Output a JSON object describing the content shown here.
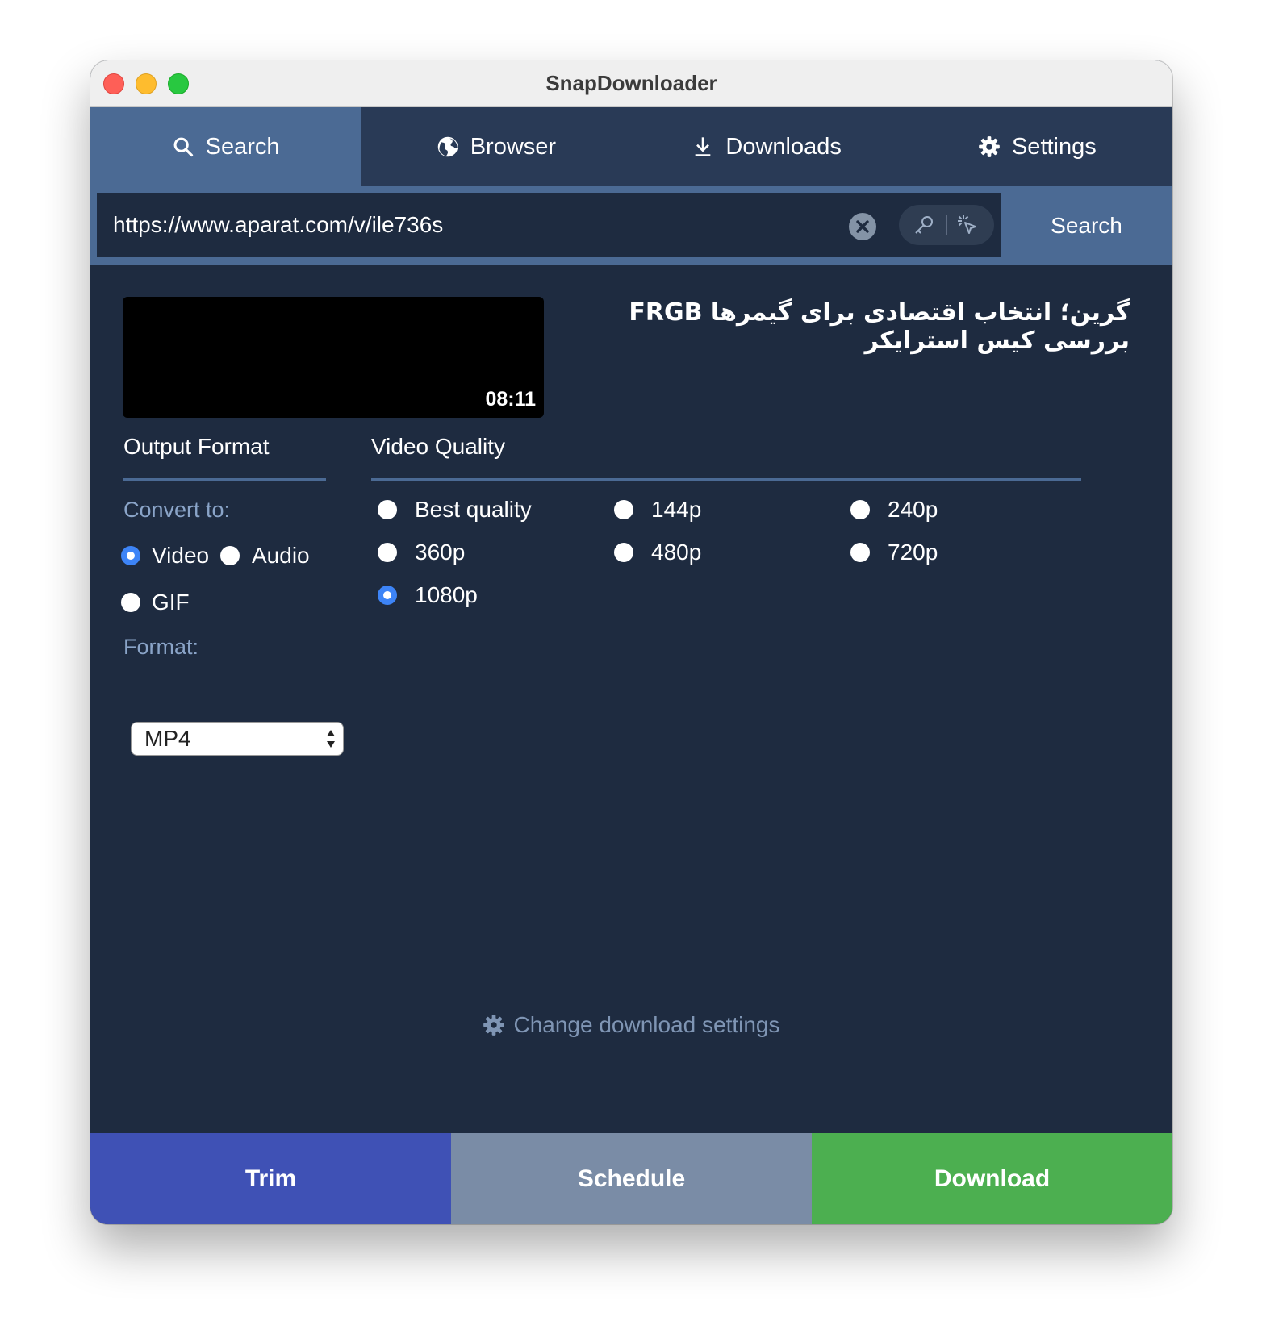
{
  "window": {
    "title": "SnapDownloader"
  },
  "tabs": [
    {
      "label": "Search",
      "icon": "search-icon",
      "active": true
    },
    {
      "label": "Browser",
      "icon": "globe-icon",
      "active": false
    },
    {
      "label": "Downloads",
      "icon": "download-icon",
      "active": false
    },
    {
      "label": "Settings",
      "icon": "gear-icon",
      "active": false
    }
  ],
  "url_bar": {
    "value": "https://www.aparat.com/v/ile736s",
    "search_label": "Search"
  },
  "video": {
    "duration": "08:11",
    "title": "گرین؛ انتخاب اقتصادی برای گیمرها FRGB بررسی کیس استرایکر"
  },
  "output_format": {
    "heading": "Output Format",
    "convert_label": "Convert to:",
    "options": [
      "Video",
      "Audio",
      "GIF"
    ],
    "selected": "Video",
    "format_label": "Format:",
    "format_value": "MP4"
  },
  "video_quality": {
    "heading": "Video Quality",
    "options": [
      "Best quality",
      "144p",
      "240p",
      "360p",
      "480p",
      "720p",
      "1080p"
    ],
    "selected": "1080p"
  },
  "footer": {
    "change_settings_label": "Change download settings",
    "trim_label": "Trim",
    "schedule_label": "Schedule",
    "download_label": "Download"
  },
  "colors": {
    "accent_tab": "#4b6a94",
    "background": "#1e2b40",
    "trim": "#3f51b5",
    "schedule": "#7a8ca6",
    "download": "#4caf50",
    "radio_selected": "#3d84f7"
  }
}
